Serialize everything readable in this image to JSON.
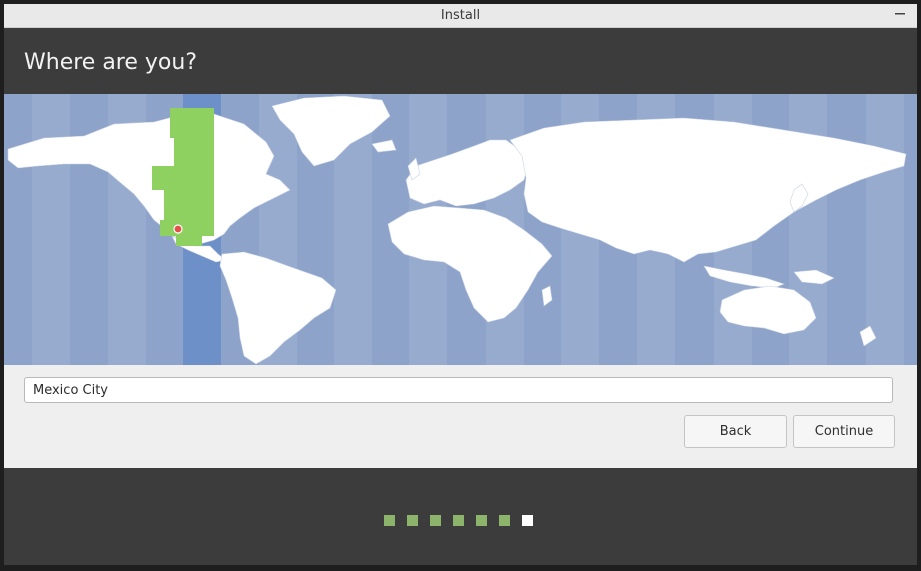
{
  "window": {
    "title": "Install"
  },
  "header": {
    "heading": "Where are you?"
  },
  "location": {
    "value": "Mexico City"
  },
  "buttons": {
    "back": "Back",
    "continue": "Continue"
  },
  "progress": {
    "total_steps": 7,
    "current_step": 7
  },
  "colors": {
    "ocean": "#8ea3c9",
    "land": "#ffffff",
    "selected_timezone_band": "#6d90c8",
    "selected_timezone_land": "#8fd160",
    "marker": "#e2504a",
    "step_done": "#8cb56b",
    "step_current": "#ffffff"
  }
}
